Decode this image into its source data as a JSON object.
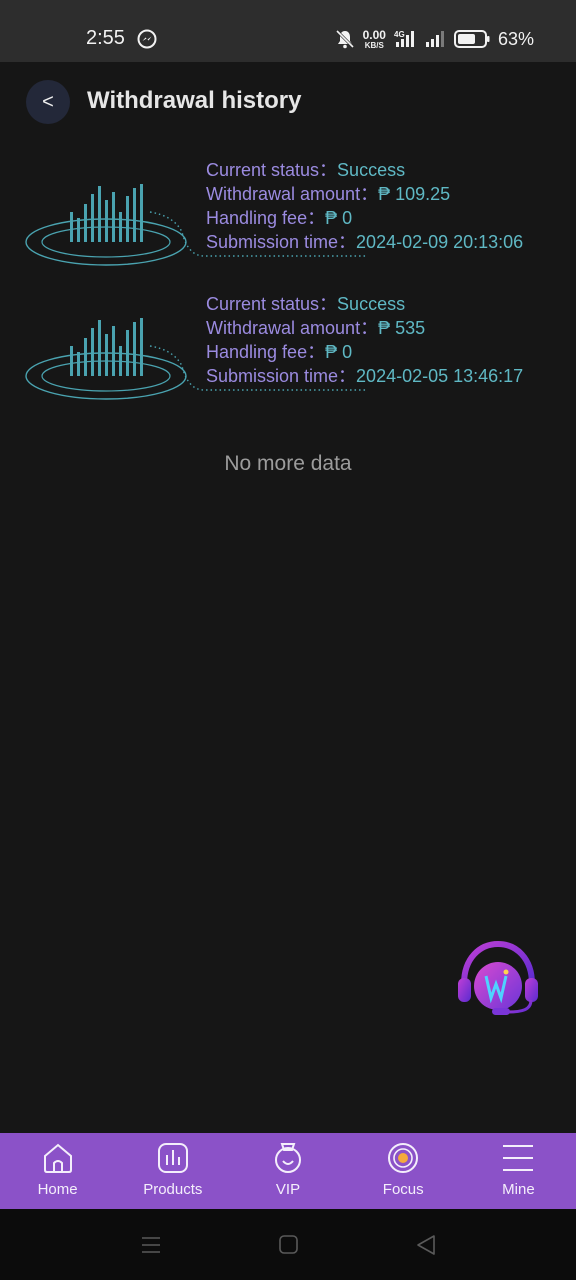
{
  "status_bar": {
    "time": "2:55",
    "net_speed": "0.00",
    "net_unit": "KB/S",
    "network": "4G",
    "battery": "63%",
    "icons": [
      "messenger-icon",
      "mute-icon",
      "signal-icon",
      "battery-icon"
    ]
  },
  "header": {
    "back_label": "<",
    "title": "Withdrawal history"
  },
  "labels": {
    "status": "Current status：",
    "amount": "Withdrawal amount：",
    "fee": "Handling fee：",
    "time": "Submission time："
  },
  "records": [
    {
      "status": "Success",
      "amount": "₱ 109.25",
      "fee": "₱ 0",
      "time": "2024-02-09 20:13:06"
    },
    {
      "status": "Success",
      "amount": "₱ 535",
      "fee": "₱ 0",
      "time": "2024-02-05 13:46:17"
    }
  ],
  "footer_text": "No more data",
  "bottom_nav": [
    {
      "label": "Home",
      "icon": "home-icon"
    },
    {
      "label": "Products",
      "icon": "products-icon"
    },
    {
      "label": "VIP",
      "icon": "vip-icon"
    },
    {
      "label": "Focus",
      "icon": "focus-icon"
    },
    {
      "label": "Mine",
      "icon": "menu-icon"
    }
  ],
  "colors": {
    "background": "#161616",
    "nav_purple": "#8b52c8",
    "label_purple": "#9b8be0",
    "value_teal": "#5fb8c4"
  }
}
